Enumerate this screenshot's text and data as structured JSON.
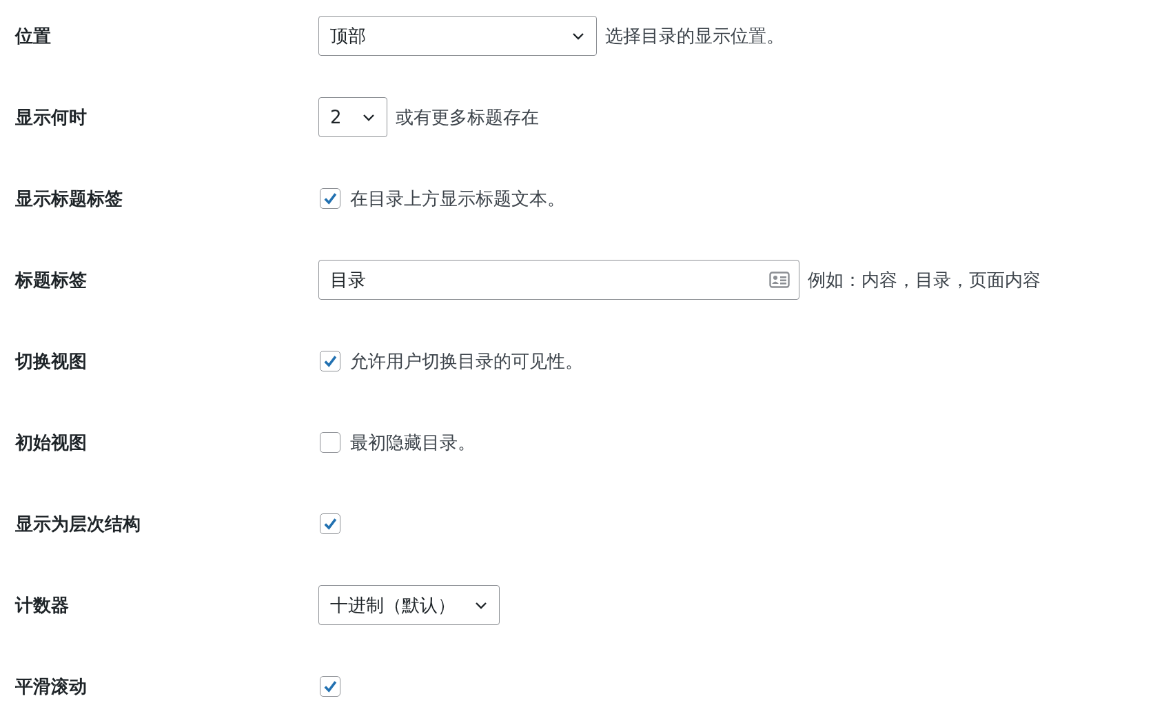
{
  "settings": [
    {
      "label": "位置",
      "kind": "select",
      "value": "顶部",
      "description": "选择目录的显示位置。"
    },
    {
      "label": "显示何时",
      "kind": "select",
      "value": "2",
      "description": "或有更多标题存在"
    },
    {
      "label": "显示标题标签",
      "kind": "checkbox",
      "checked": true,
      "description": "在目录上方显示标题文本。"
    },
    {
      "label": "标题标签",
      "kind": "text",
      "value": "目录",
      "description": "例如：内容，目录，页面内容"
    },
    {
      "label": "切换视图",
      "kind": "checkbox",
      "checked": true,
      "description": "允许用户切换目录的可见性。"
    },
    {
      "label": "初始视图",
      "kind": "checkbox",
      "checked": false,
      "description": "最初隐藏目录。"
    },
    {
      "label": "显示为层次结构",
      "kind": "checkbox",
      "checked": true
    },
    {
      "label": "计数器",
      "kind": "select",
      "value": "十进制（默认）"
    },
    {
      "label": "平滑滚动",
      "kind": "checkbox",
      "checked": true
    }
  ]
}
